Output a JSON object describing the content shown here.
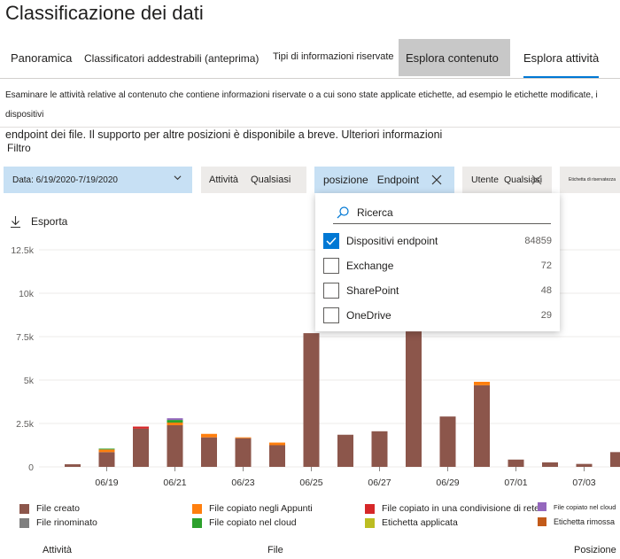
{
  "page": {
    "title": "Classificazione dei dati"
  },
  "tabs": [
    {
      "label": "Panoramica"
    },
    {
      "label": "Classificatori addestrabili (anteprima)"
    },
    {
      "label": "Tipi di informazioni riservate"
    },
    {
      "label": "Esplora contenuto"
    },
    {
      "label": "Esplora attività"
    }
  ],
  "description": {
    "line1": "Esaminare le attività relative al contenuto che contiene informazioni riservate o a cui sono state applicate etichette, ad esempio le etichette modificate, i dispositivi",
    "line2": "endpoint dei file. Il supporto per altre posizioni è disponibile a breve. Ulteriori informazioni"
  },
  "filters": {
    "label": "Filtro",
    "date": "Data: 6/19/2020-7/19/2020",
    "activity_key": "Attività",
    "activity_value": "Qualsiasi",
    "location_key": "posizione",
    "location_value": "Endpoint",
    "user_key": "Utente",
    "user_value": "Qualsiasi",
    "sensitivity_label": "Etichetta di riservatezza"
  },
  "export": {
    "label": "Esporta"
  },
  "location_dropdown": {
    "search_placeholder": "Ricerca",
    "options": [
      {
        "label": "Dispositivi endpoint",
        "count": "84859",
        "checked": true
      },
      {
        "label": "Exchange",
        "count": "72",
        "checked": false
      },
      {
        "label": "SharePoint",
        "count": "48",
        "checked": false
      },
      {
        "label": "OneDrive",
        "count": "29",
        "checked": false
      }
    ]
  },
  "chart_data": {
    "type": "bar",
    "stacked": true,
    "ylim": [
      0,
      12500
    ],
    "yticks": [
      "0",
      "2.5k",
      "5k",
      "7.5k",
      "10k",
      "12.5k"
    ],
    "ytick_values": [
      0,
      2500,
      5000,
      7500,
      10000,
      12500
    ],
    "x_tick_labels": [
      "06/19",
      "06/21",
      "06/23",
      "06/25",
      "06/27",
      "06/29",
      "07/01",
      "07/03"
    ],
    "categories": [
      "06/18",
      "06/19",
      "06/20",
      "06/21",
      "06/22",
      "06/23",
      "06/24",
      "06/25",
      "06/26",
      "06/27",
      "06/28",
      "06/29",
      "06/30",
      "07/01",
      "07/02",
      "07/03",
      "07/04"
    ],
    "series": [
      {
        "name": "File creato",
        "color": "#8c564b",
        "values": [
          150,
          850,
          2200,
          2400,
          1700,
          1650,
          1250,
          7700,
          1850,
          2050,
          7800,
          2900,
          4700,
          420,
          260,
          170,
          850
        ]
      },
      {
        "name": "File copiato negli Appunti",
        "color": "#ff7f0e",
        "values": [
          0,
          150,
          0,
          150,
          200,
          50,
          150,
          0,
          0,
          0,
          0,
          0,
          200,
          0,
          0,
          0,
          0
        ]
      },
      {
        "name": "File copiato in una condivisione di rete",
        "color": "#d62728",
        "values": [
          0,
          0,
          120,
          0,
          0,
          0,
          0,
          0,
          0,
          0,
          0,
          0,
          0,
          0,
          0,
          0,
          0
        ]
      },
      {
        "name": "File copiato nel cloud",
        "color": "#2ca02c",
        "values": [
          0,
          50,
          0,
          150,
          0,
          0,
          0,
          0,
          0,
          0,
          0,
          0,
          0,
          0,
          0,
          0,
          0
        ]
      },
      {
        "name": "File rinominato",
        "color": "#7f7f7f",
        "values": [
          0,
          0,
          0,
          0,
          0,
          0,
          0,
          0,
          0,
          0,
          0,
          0,
          0,
          0,
          0,
          0,
          0
        ]
      },
      {
        "name": "Etichetta applicata",
        "color": "#bcbd22",
        "values": [
          0,
          0,
          0,
          0,
          0,
          0,
          0,
          0,
          0,
          0,
          0,
          0,
          0,
          0,
          0,
          0,
          0
        ]
      },
      {
        "name": "File copiato nel cloud",
        "color": "#9467bd",
        "values": [
          0,
          0,
          0,
          100,
          0,
          0,
          0,
          0,
          0,
          0,
          0,
          0,
          0,
          0,
          0,
          0,
          0
        ]
      },
      {
        "name": "Etichetta rimossa",
        "color": "#c25a1a",
        "values": [
          0,
          0,
          0,
          0,
          0,
          0,
          0,
          0,
          0,
          0,
          0,
          0,
          0,
          0,
          0,
          0,
          0
        ]
      }
    ]
  },
  "legend": [
    {
      "label": "File creato",
      "color": "#8c564b"
    },
    {
      "label": "File rinominato",
      "color": "#7f7f7f"
    },
    {
      "label": "File copiato negli Appunti",
      "color": "#ff7f0e"
    },
    {
      "label": "File copiato nel cloud",
      "color": "#2ca02c"
    },
    {
      "label": "File copiato in una condivisione di rete",
      "color": "#d62728"
    },
    {
      "label": "Etichetta applicata",
      "color": "#bcbd22"
    },
    {
      "label": "File copiato nel cloud",
      "color": "#9467bd"
    },
    {
      "label": "Etichetta rimossa",
      "color": "#c25a1a"
    }
  ],
  "table_headers": [
    "Attività",
    "File",
    "Posizione"
  ]
}
